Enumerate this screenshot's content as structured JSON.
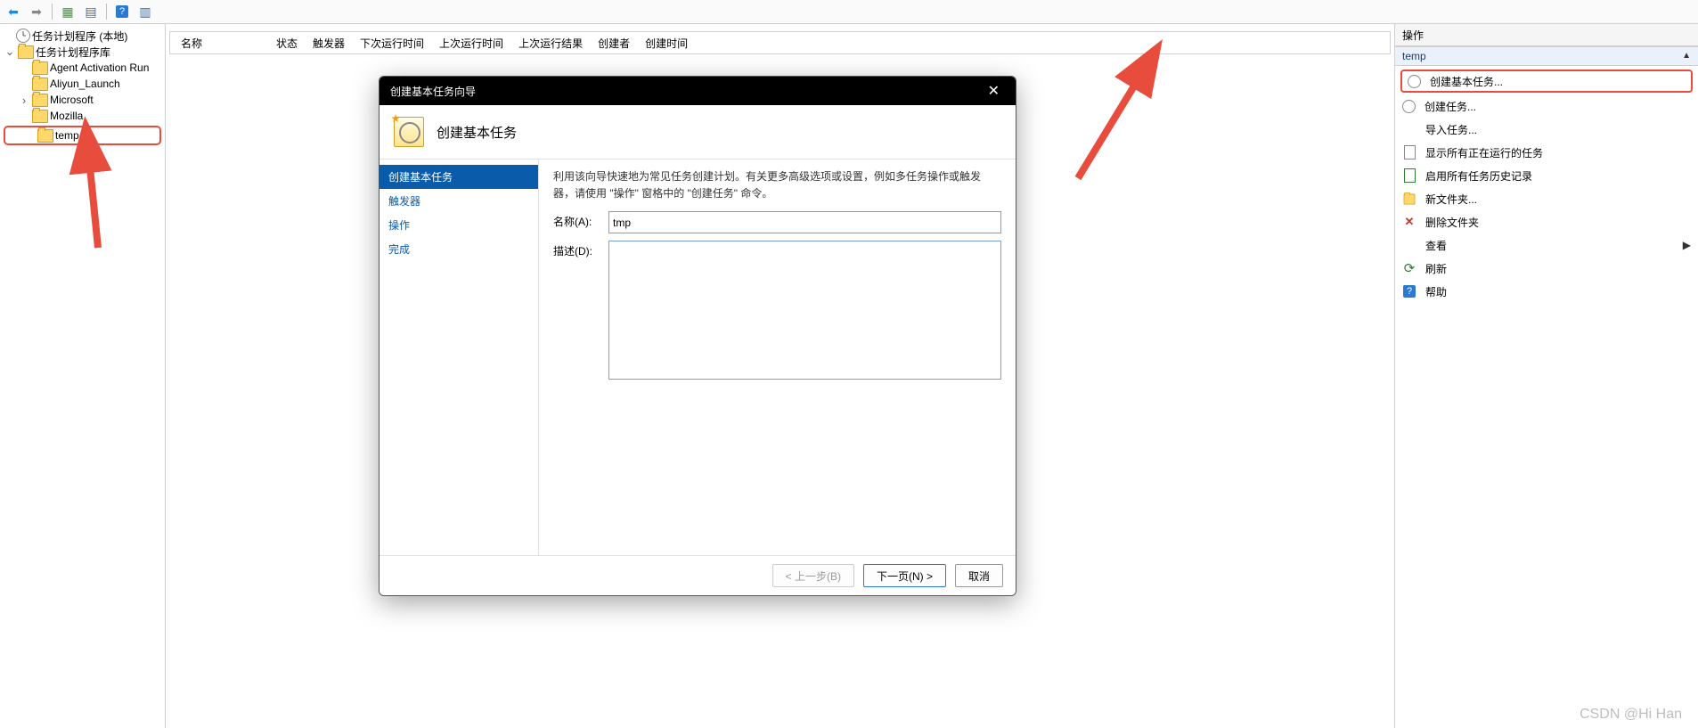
{
  "toolbar": {
    "back_icon": "back-icon",
    "fwd_icon": "forward-icon",
    "refresh_icon": "refresh-icon",
    "props_icon": "properties-icon",
    "help_icon": "help-icon",
    "export_icon": "export-icon"
  },
  "tree": {
    "root": "任务计划程序 (本地)",
    "library": "任务计划程序库",
    "items": [
      "Agent Activation Run",
      "Aliyun_Launch",
      "Microsoft",
      "Mozilla",
      "temp"
    ]
  },
  "list": {
    "columns": [
      "名称",
      "状态",
      "触发器",
      "下次运行时间",
      "上次运行时间",
      "上次运行结果",
      "创建者",
      "创建时间"
    ]
  },
  "actions": {
    "title": "操作",
    "group": "temp",
    "items": [
      {
        "label": "创建基本任务...",
        "icon": "clock-icon",
        "hl": true
      },
      {
        "label": "创建任务...",
        "icon": "clock-icon"
      },
      {
        "label": "导入任务...",
        "icon": ""
      },
      {
        "label": "显示所有正在运行的任务",
        "icon": "doc-icon"
      },
      {
        "label": "启用所有任务历史记录",
        "icon": "doc-green-icon"
      },
      {
        "label": "新文件夹...",
        "icon": "folder-icon"
      },
      {
        "label": "删除文件夹",
        "icon": "x-icon"
      },
      {
        "label": "查看",
        "icon": "",
        "sub": true
      },
      {
        "label": "刷新",
        "icon": "refresh-icon"
      },
      {
        "label": "帮助",
        "icon": "help-icon"
      }
    ]
  },
  "modal": {
    "title": "创建基本任务向导",
    "banner": "创建基本任务",
    "nav": [
      "创建基本任务",
      "触发器",
      "操作",
      "完成"
    ],
    "hint": "利用该向导快速地为常见任务创建计划。有关更多高级选项或设置，例如多任务操作或触发器，请使用 \"操作\" 窗格中的 \"创建任务\" 命令。",
    "name_label": "名称(A):",
    "name_value": "tmp",
    "desc_label": "描述(D):",
    "buttons": {
      "back": "< 上一步(B)",
      "next": "下一页(N) >",
      "cancel": "取消"
    }
  },
  "watermark": "CSDN @Hi Han"
}
